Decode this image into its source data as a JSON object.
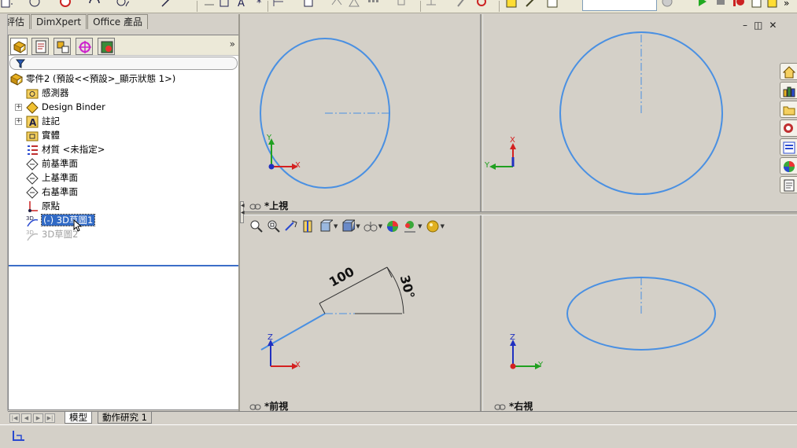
{
  "command_tabs": [
    "評估",
    "DimXpert",
    "Office 產品"
  ],
  "colors": {
    "sketch_blue": "#4a90e2",
    "axis_x": "#d42020",
    "axis_y": "#20a020",
    "axis_z": "#2030c0",
    "selection": "#316ac5"
  },
  "feature_tree": {
    "filter_icon": "funnel-icon",
    "expand_icon": "chevron-double-right",
    "items": [
      {
        "label": "零件2  (預設<<預設>_顯示狀態 1>)",
        "icon": "part-icon"
      },
      {
        "label": "感測器",
        "icon": "sensor-folder-icon"
      },
      {
        "label": "Design Binder",
        "icon": "design-binder-icon",
        "expandable": true
      },
      {
        "label": "註記",
        "icon": "annotations-icon",
        "expandable": true
      },
      {
        "label": "實體",
        "icon": "solid-bodies-folder-icon"
      },
      {
        "label": "材質 <未指定>",
        "icon": "material-icon"
      },
      {
        "label": "前基準面",
        "icon": "plane-icon"
      },
      {
        "label": "上基準面",
        "icon": "plane-icon"
      },
      {
        "label": "右基準面",
        "icon": "plane-icon"
      },
      {
        "label": "原點",
        "icon": "origin-icon"
      },
      {
        "label": "(-) 3D草圖1",
        "icon": "sketch3d-icon",
        "selected": true
      },
      {
        "label": "3D草圖2",
        "icon": "sketch3d-icon",
        "dimmed": true
      }
    ]
  },
  "viewports": {
    "top_left": {
      "label": "*上視"
    },
    "top_right": {
      "label": ""
    },
    "bottom_left": {
      "label": "*前視"
    },
    "bottom_right": {
      "label": "*右視"
    }
  },
  "dimensions": {
    "length": "100",
    "angle": "30°"
  },
  "axis_labels": {
    "x": "X",
    "y": "Y",
    "z": "Z"
  },
  "bottom_tabs": [
    "模型",
    "動作研究 1"
  ],
  "window_controls": [
    "minimize",
    "restore",
    "close"
  ]
}
